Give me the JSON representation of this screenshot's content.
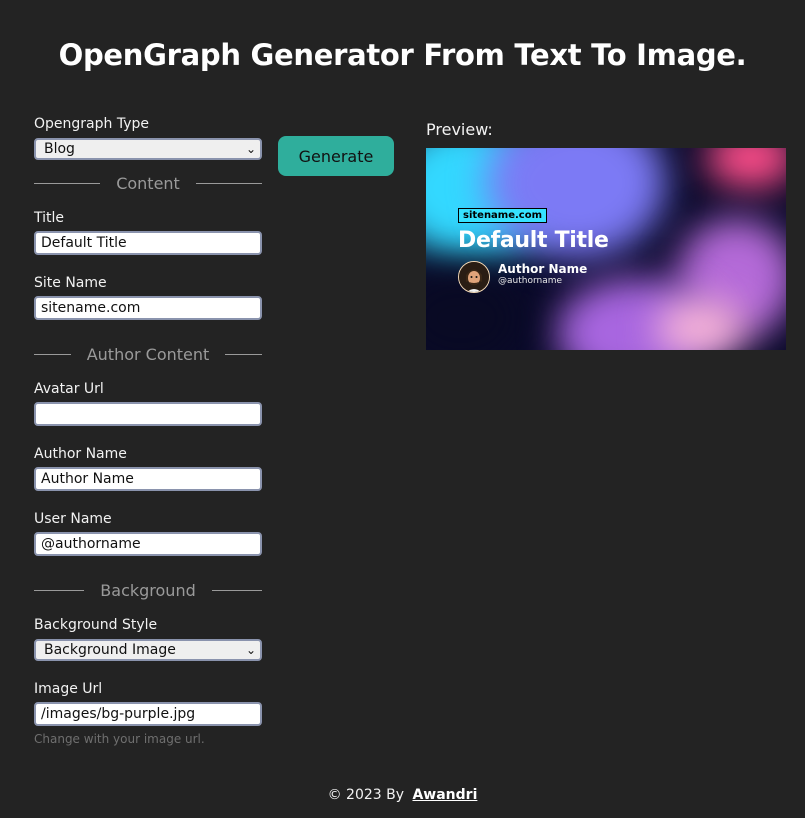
{
  "page": {
    "title": "OpenGraph Generator From Text To Image."
  },
  "form": {
    "opengraph_type": {
      "label": "Opengraph Type",
      "value": "Blog"
    },
    "generate_label": "Generate",
    "content_divider": "Content",
    "title": {
      "label": "Title",
      "value": "Default Title"
    },
    "site_name": {
      "label": "Site Name",
      "value": "sitename.com"
    },
    "author_divider": "Author Content",
    "avatar_url": {
      "label": "Avatar Url",
      "value": ""
    },
    "author_name": {
      "label": "Author Name",
      "value": "Author Name"
    },
    "user_name": {
      "label": "User Name",
      "value": "@authorname"
    },
    "background_divider": "Background",
    "background_style": {
      "label": "Background Style",
      "value": "Background Image"
    },
    "image_url": {
      "label": "Image Url",
      "value": "/images/bg-purple.jpg",
      "hint": "Change with your image url."
    }
  },
  "preview": {
    "label": "Preview:",
    "site": "sitename.com",
    "title": "Default Title",
    "author": "Author Name",
    "user": "@authorname"
  },
  "footer": {
    "text": "© 2023 By",
    "link": "Awandri"
  },
  "colors": {
    "background": "#232323",
    "accent": "#2fae9c",
    "site_badge": "#36e2ff"
  }
}
